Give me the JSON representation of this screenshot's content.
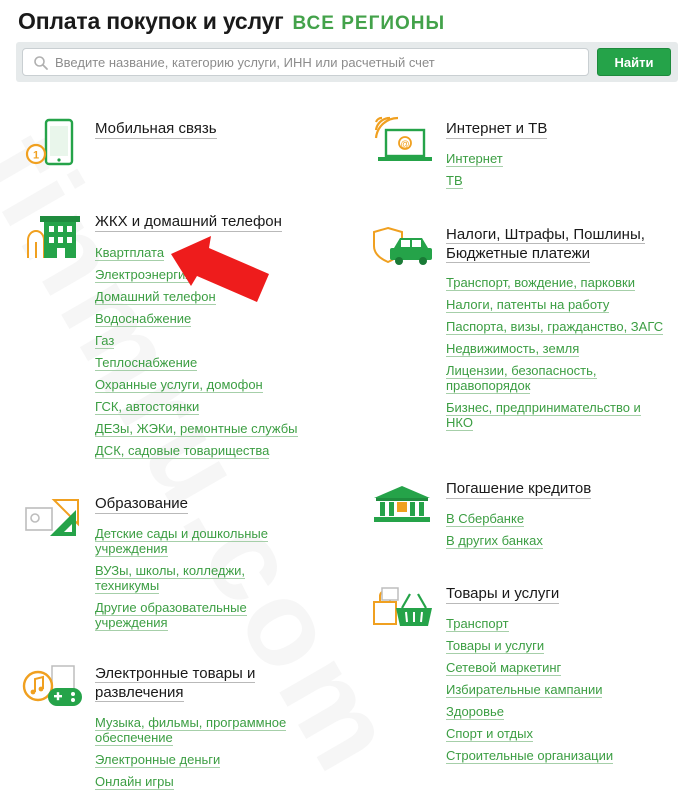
{
  "header": {
    "title": "Оплата покупок и услуг",
    "regions_link": "ВСЕ РЕГИОНЫ"
  },
  "search": {
    "placeholder": "Введите название, категорию услуги, ИНН или расчетный счет",
    "value": "",
    "button_label": "Найти"
  },
  "watermark": "finmru.com",
  "categories": {
    "mobile": {
      "title": "Мобильная связь",
      "icon": "mobile-phone-icon",
      "links": []
    },
    "internet": {
      "title": "Интернет и ТВ",
      "icon": "laptop-wifi-icon",
      "links": [
        "Интернет",
        "ТВ"
      ]
    },
    "housing": {
      "title": "ЖКХ и домашний телефон",
      "icon": "building-icon",
      "links": [
        "Квартплата",
        "Электроэнергия",
        "Домашний телефон",
        "Водоснабжение",
        "Газ",
        "Теплоснабжение",
        "Охранные услуги, домофон",
        "ГСК, автостоянки",
        "ДЕЗы, ЖЭКи, ремонтные службы",
        "ДСК, садовые товарищества"
      ]
    },
    "taxes": {
      "title": "Налоги, Штрафы, Пошлины, Бюджетные платежи",
      "icon": "car-shield-icon",
      "links": [
        "Транспорт, вождение, парковки",
        "Налоги, патенты на работу",
        "Паспорта, визы, гражданство, ЗАГС",
        "Недвижимость, земля",
        "Лицензии, безопасность, правопорядок",
        "Бизнес, предпринимательство и НКО"
      ]
    },
    "education": {
      "title": "Образование",
      "icon": "ruler-triangle-icon",
      "links": [
        "Детские сады и дошкольные учреждения",
        "ВУЗы, школы, колледжи, техникумы",
        "Другие образовательные учреждения"
      ]
    },
    "credits": {
      "title": "Погашение кредитов",
      "icon": "bank-icon",
      "links": [
        "В Сбербанке",
        "В других банках"
      ]
    },
    "goods": {
      "title": "Товары и услуги",
      "icon": "shopping-basket-icon",
      "links": [
        "Транспорт",
        "Товары и услуги",
        "Сетевой маркетинг",
        "Избирательные кампании",
        "Здоровье",
        "Спорт и отдых",
        "Строительные организации"
      ]
    },
    "entertainment": {
      "title": "Электронные товары и развлечения",
      "icon": "gamepad-music-icon",
      "links": [
        "Музыка, фильмы, программное обеспечение",
        "Электронные деньги",
        "Онлайн игры"
      ]
    }
  },
  "colors": {
    "green": "#25a349",
    "link_green": "#3c9e43",
    "accent_orange": "#f0a020",
    "arrow_red": "#ee1c1c"
  }
}
